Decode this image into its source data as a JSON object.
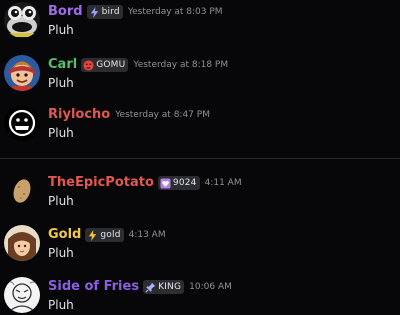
{
  "messages": [
    {
      "author": "Bord",
      "author_color": "#a06be8",
      "badge": "bird",
      "badge_icon": "lightning-icon",
      "timestamp": "Yesterday at 8:03 PM",
      "content": "Pluh"
    },
    {
      "author": "Carl",
      "author_color": "#55c16d",
      "badge": "GOMU",
      "badge_icon": "angry-face-icon",
      "timestamp": "Yesterday at 8:18 PM",
      "content": "Pluh"
    },
    {
      "author": "Riylocho",
      "author_color": "#e1584e",
      "badge": "",
      "badge_icon": "",
      "timestamp": "Yesterday at 8:47 PM",
      "content": "Pluh"
    },
    {
      "author": "TheEpicPotato",
      "author_color": "#e1584e",
      "badge": "9024",
      "badge_icon": "heart-icon",
      "timestamp": "4:11 AM",
      "content": "Pluh"
    },
    {
      "author": "Gold",
      "author_color": "#f0c94b",
      "badge": "gold",
      "badge_icon": "lightning-icon",
      "timestamp": "4:13 AM",
      "content": "Pluh"
    },
    {
      "author": "Side of Fries",
      "author_color": "#8b5ee0",
      "badge": "KING",
      "badge_icon": "pin-icon",
      "timestamp": "10:06 AM",
      "content": "Pluh"
    }
  ]
}
